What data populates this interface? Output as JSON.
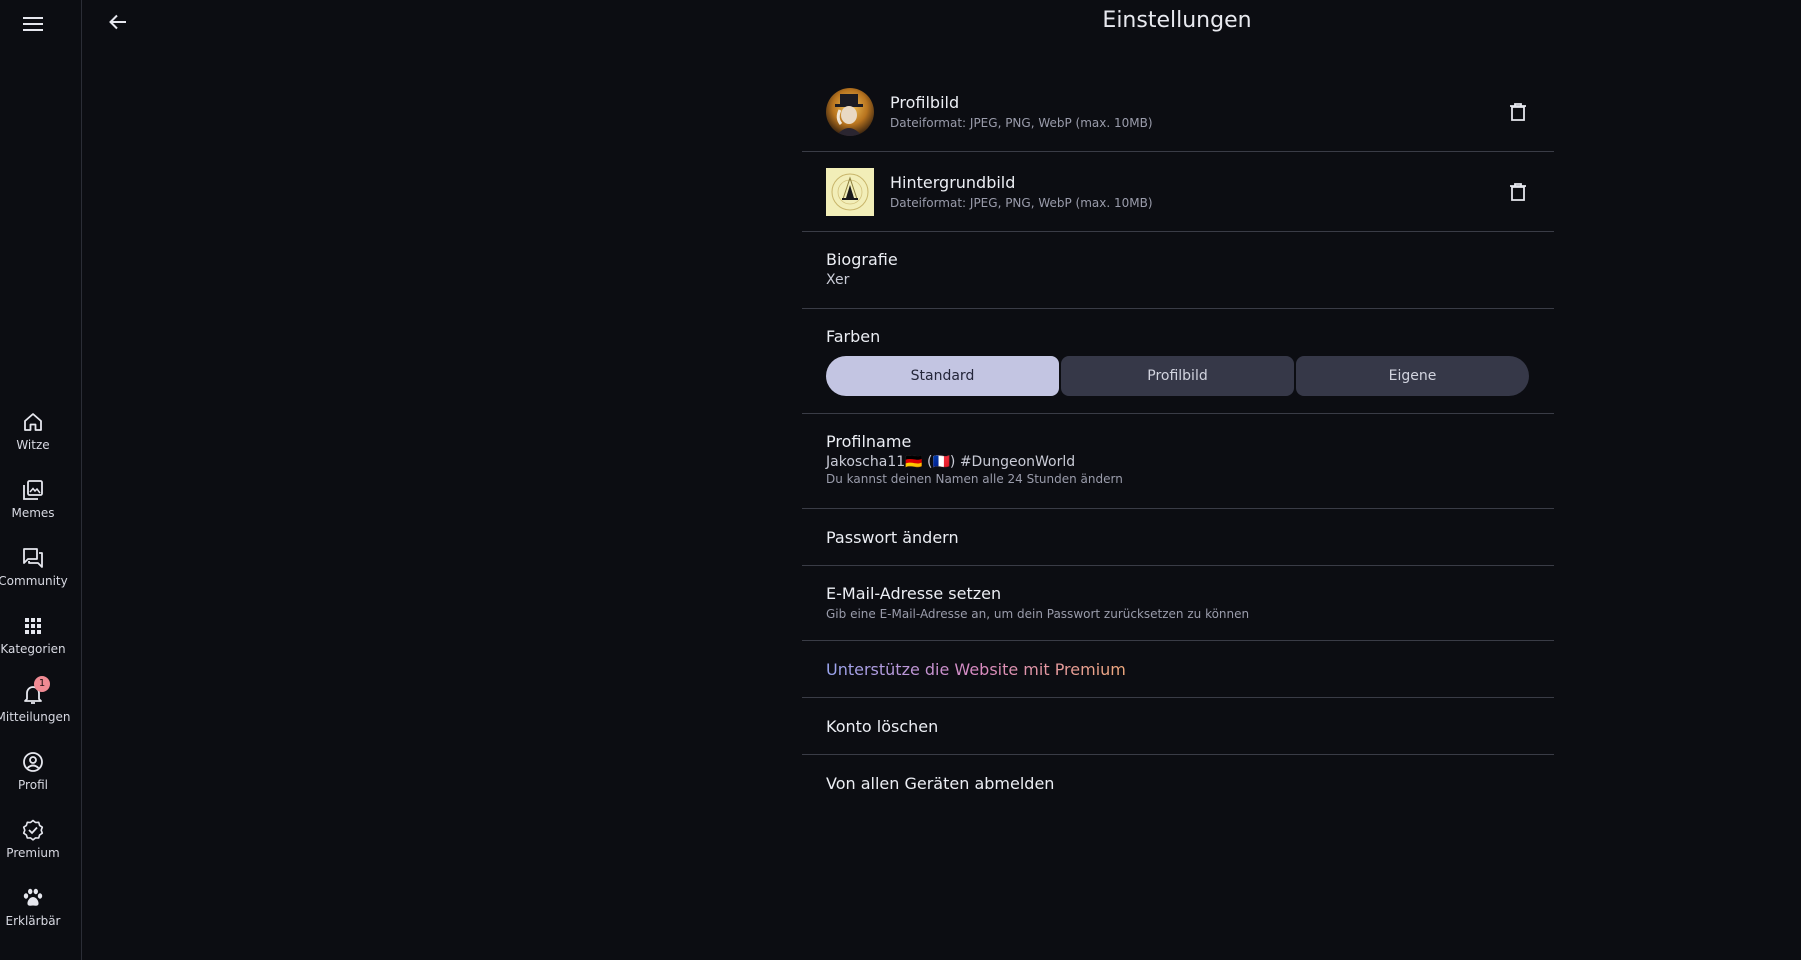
{
  "header": {
    "title": "Einstellungen"
  },
  "sidebar": {
    "items": [
      {
        "label": "Witze",
        "icon": "home-icon"
      },
      {
        "label": "Memes",
        "icon": "gallery-icon"
      },
      {
        "label": "Community",
        "icon": "forum-icon"
      },
      {
        "label": "Kategorien",
        "icon": "grid-icon"
      },
      {
        "label": "Mitteilungen",
        "icon": "bell-icon",
        "badge": "1"
      },
      {
        "label": "Profil",
        "icon": "account-icon"
      },
      {
        "label": "Premium",
        "icon": "verified-icon"
      },
      {
        "label": "Erklärbär",
        "icon": "paw-icon"
      }
    ]
  },
  "settings": {
    "profile_image": {
      "title": "Profilbild",
      "subtitle": "Dateiformat: JPEG, PNG, WebP (max. 10MB)"
    },
    "background_image": {
      "title": "Hintergrundbild",
      "subtitle": "Dateiformat: JPEG, PNG, WebP (max. 10MB)"
    },
    "bio": {
      "title": "Biografie",
      "value": "Xer"
    },
    "colors": {
      "title": "Farben",
      "options": [
        "Standard",
        "Profilbild",
        "Eigene"
      ],
      "selected": "Standard"
    },
    "profile_name": {
      "title": "Profilname",
      "value": "Jakoscha11🇩🇪 (🇫🇷) #DungeonWorld",
      "hint": "Du kannst deinen Namen alle 24 Stunden ändern"
    },
    "password": {
      "title": "Passwort ändern"
    },
    "email": {
      "title": "E-Mail-Adresse setzen",
      "subtitle": "Gib eine E-Mail-Adresse an, um dein Passwort zurücksetzen zu können"
    },
    "premium": {
      "title": "Unterstütze die Website mit Premium"
    },
    "delete_account": {
      "title": "Konto löschen"
    },
    "logout_all": {
      "title": "Von allen Geräten abmelden"
    }
  },
  "colors": {
    "accent": "#c3c5e2",
    "background": "#0c0d12",
    "badge": "#f08a93"
  }
}
